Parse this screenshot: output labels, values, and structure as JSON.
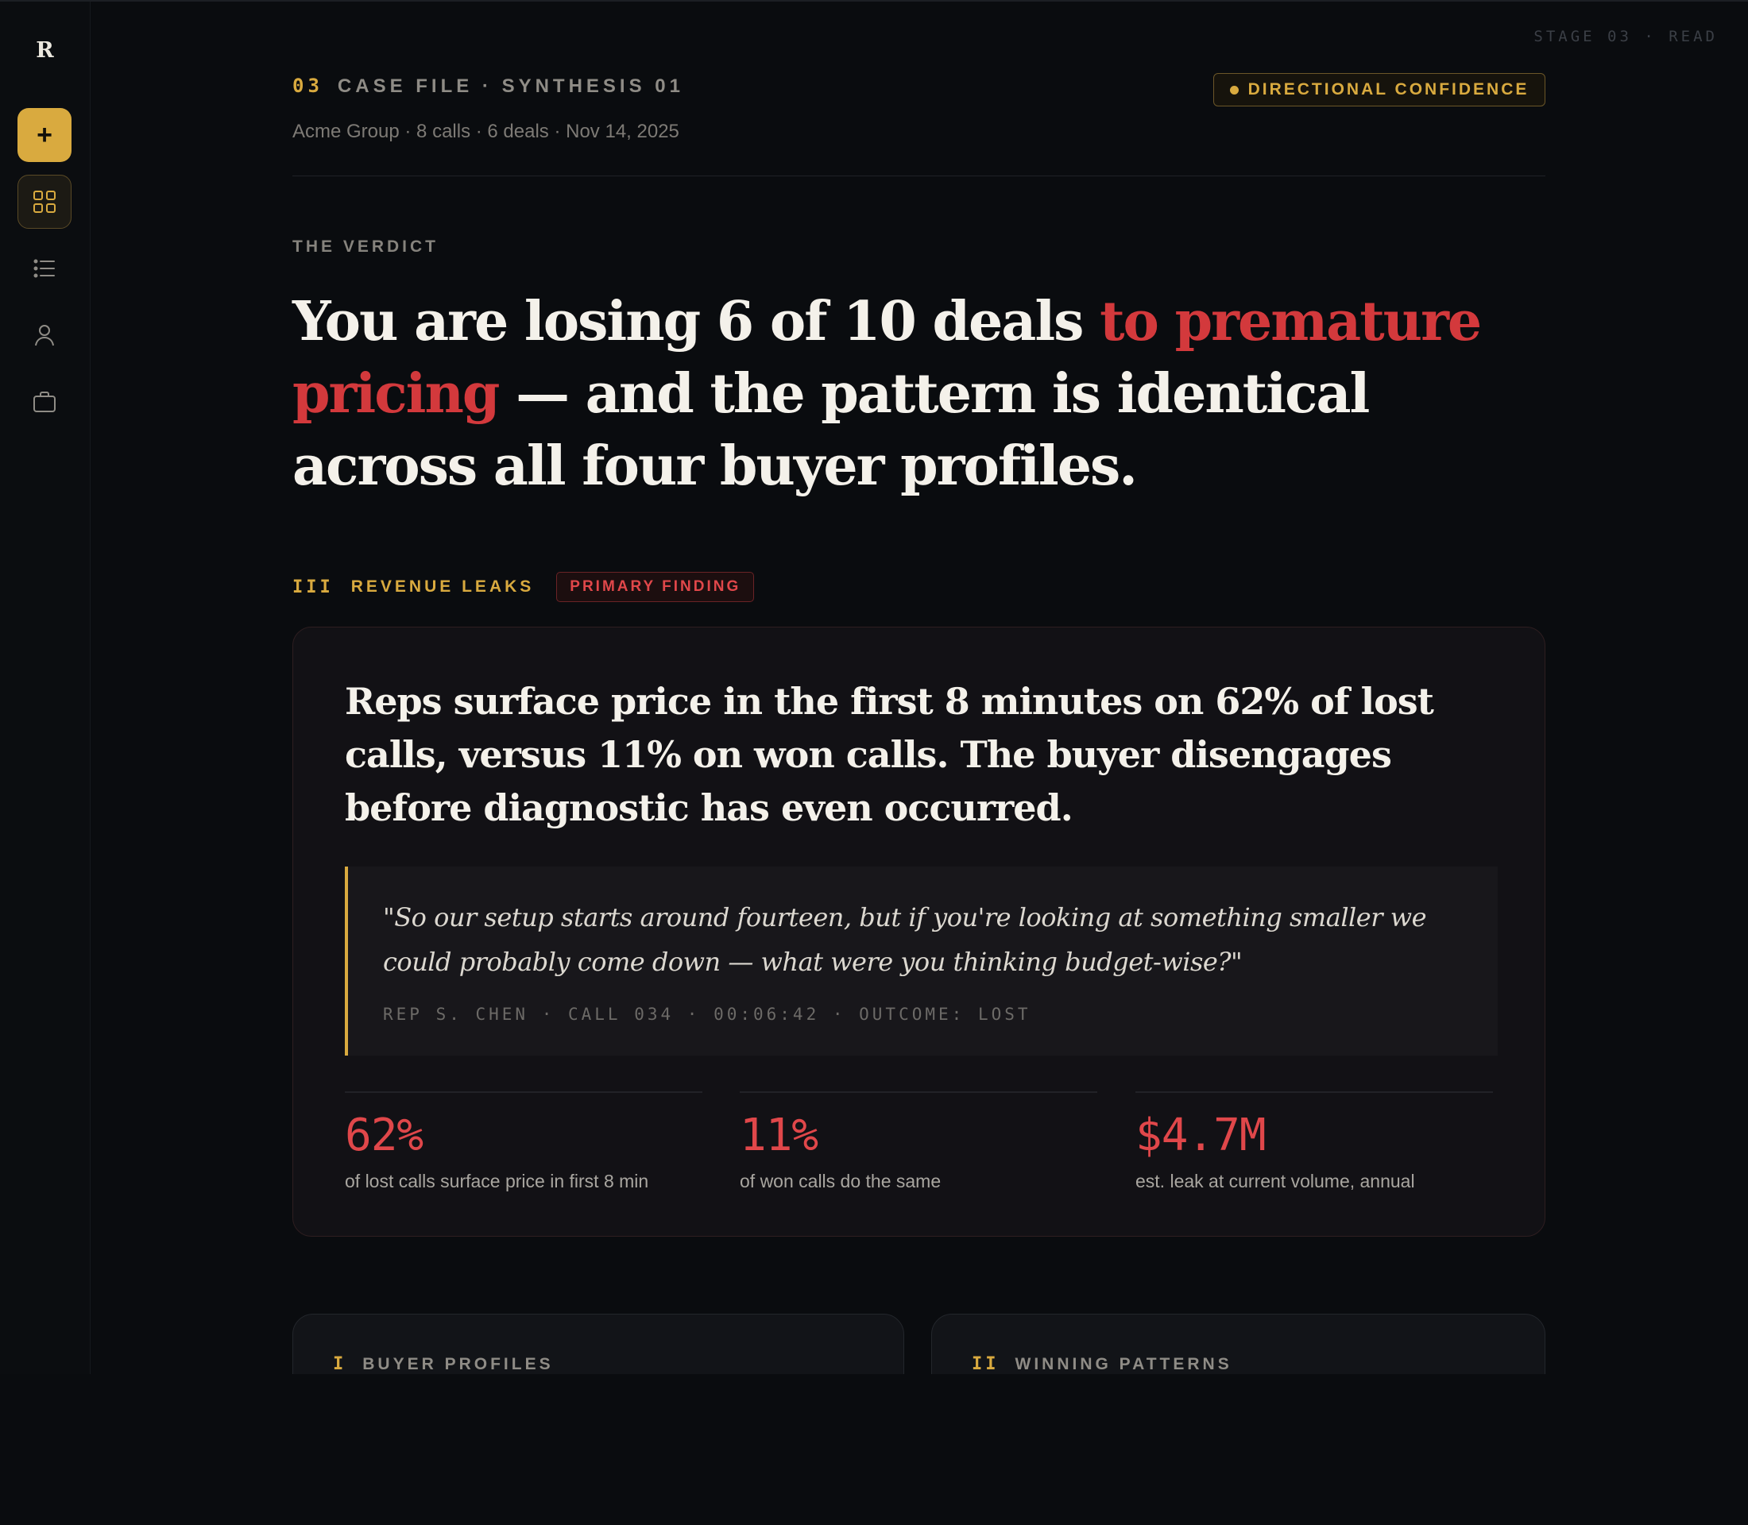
{
  "rail": {
    "logo": "R",
    "add_label": "+",
    "icons": [
      "dashboard-grid-icon",
      "list-icon",
      "user-icon",
      "briefcase-icon"
    ]
  },
  "stage_label": "STAGE 03 · READ",
  "header": {
    "number": "03",
    "eyebrow": "CASE FILE · SYNTHESIS 01",
    "meta": "Acme Group · 8 calls · 6 deals · Nov 14, 2025",
    "confidence": "DIRECTIONAL CONFIDENCE"
  },
  "verdict": {
    "label": "THE VERDICT",
    "headline_pre": "You are losing 6 of 10 deals ",
    "headline_accent": "to premature pricing",
    "headline_post": " — and the pattern is identical across all four buyer profiles."
  },
  "section": {
    "roman": "III",
    "title": "REVENUE LEAKS",
    "badge": "PRIMARY FINDING"
  },
  "finding": {
    "text": "Reps surface price in the first 8 minutes on 62% of lost calls, versus 11% on won calls. The buyer disengages before diagnostic has even occurred.",
    "quote": "\"So our setup starts around fourteen, but if you're looking at something smaller we could probably come down — what were you thinking budget-wise?\"",
    "citation": "REP S. CHEN · CALL 034 · 00:06:42 · OUTCOME: LOST",
    "stats": [
      {
        "value": "62%",
        "label": "of lost calls surface price in first 8 min"
      },
      {
        "value": "11%",
        "label": "of won calls do the same"
      },
      {
        "value": "$4.7M",
        "label": "est. leak at current volume, annual"
      }
    ]
  },
  "bottom_cards": [
    {
      "roman": "I",
      "title": "BUYER PROFILES"
    },
    {
      "roman": "II",
      "title": "WINNING PATTERNS"
    }
  ],
  "colors": {
    "background": "#0a0c0f",
    "accent_gold": "#d9aa3f",
    "accent_red": "#d3393c",
    "text": "#f4f1ea"
  }
}
